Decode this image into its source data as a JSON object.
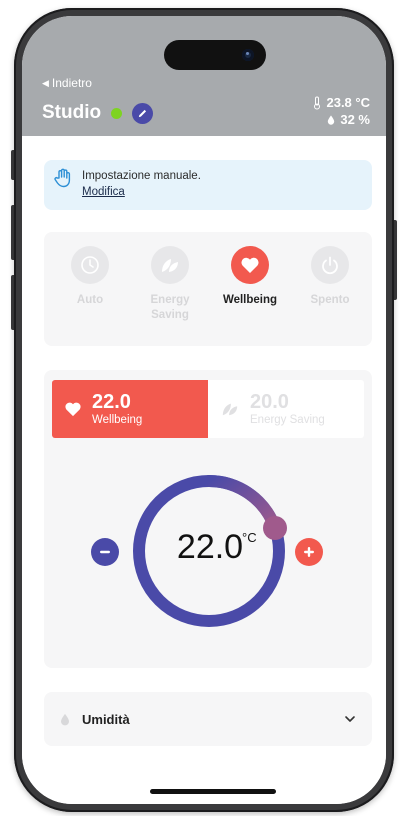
{
  "header": {
    "back_label": "Indietro",
    "room_title": "Studio",
    "temperature": "23.8 °C",
    "humidity": "32 %",
    "status_color": "#7ed321"
  },
  "banner": {
    "text": "Impostazione manuale.",
    "link": "Modifica"
  },
  "modes": [
    {
      "label": "Auto",
      "icon": "clock-icon",
      "active": false
    },
    {
      "label": "Energy Saving",
      "icon": "leaf-icon",
      "active": false
    },
    {
      "label": "Wellbeing",
      "icon": "heart-icon",
      "active": true
    },
    {
      "label": "Spento",
      "icon": "power-icon",
      "active": false
    }
  ],
  "setpoints": [
    {
      "value": "22.0",
      "label": "Wellbeing",
      "icon": "heart-icon",
      "active": true
    },
    {
      "value": "20.0",
      "label": "Energy Saving",
      "icon": "leaf-icon",
      "active": false
    }
  ],
  "dial": {
    "value": "22.0",
    "unit": "°C",
    "track_color": "#4a4aa8",
    "accent_color": "#a05a8c"
  },
  "humidity_section": {
    "label": "Umidità"
  },
  "colors": {
    "accent_red": "#f2594e",
    "accent_blue": "#4a4aa8",
    "header_gray": "#a7aaad"
  }
}
